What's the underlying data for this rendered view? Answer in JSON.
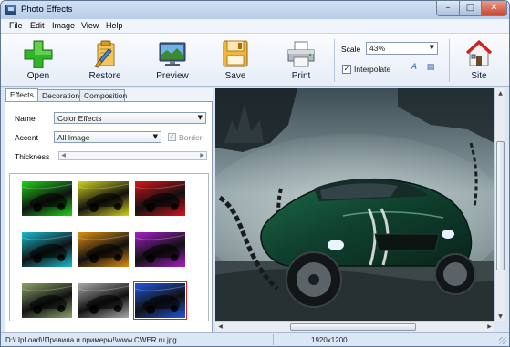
{
  "window": {
    "title": "Photo Effects",
    "icon": "app-icon"
  },
  "menu": [
    "File",
    "Edit",
    "Image",
    "View",
    "Help"
  ],
  "toolbar": {
    "open_label": "Open",
    "restore_label": "Restore",
    "preview_label": "Preview",
    "save_label": "Save",
    "print_label": "Print",
    "site_label": "Site",
    "scale_label": "Scale",
    "scale_value": "43%",
    "interpolate_label": "Interpolate",
    "interpolate_checked": true
  },
  "tabs": [
    "Effects",
    "Decoration",
    "Composition"
  ],
  "effects": {
    "name_label": "Name",
    "name_value": "Color Effects",
    "accent_label": "Accent",
    "accent_value": "All Image",
    "border_label": "Border",
    "border_checked": true,
    "thickness_label": "Thickness"
  },
  "thumbnails": [
    {
      "tint": "#1fd21a",
      "selected": false
    },
    {
      "tint": "#d3d21a",
      "selected": false
    },
    {
      "tint": "#d8141a",
      "selected": false
    },
    {
      "tint": "#19bcd0",
      "selected": false
    },
    {
      "tint": "#dd8e12",
      "selected": false
    },
    {
      "tint": "#a71fc8",
      "selected": false
    },
    {
      "tint": "#8ca46a",
      "selected": false
    },
    {
      "tint": "#a8a8a8",
      "selected": false
    },
    {
      "tint": "#1f56e2",
      "selected": true
    }
  ],
  "status": {
    "path": "D:\\UpLoad\\!Правила и примеры!\\www.CWER.ru.jpg",
    "resolution": "1920x1200"
  },
  "colors": {
    "accent": "#5f7692",
    "selected_thumbnail": "#e02020",
    "window_close": "#c9462f"
  }
}
